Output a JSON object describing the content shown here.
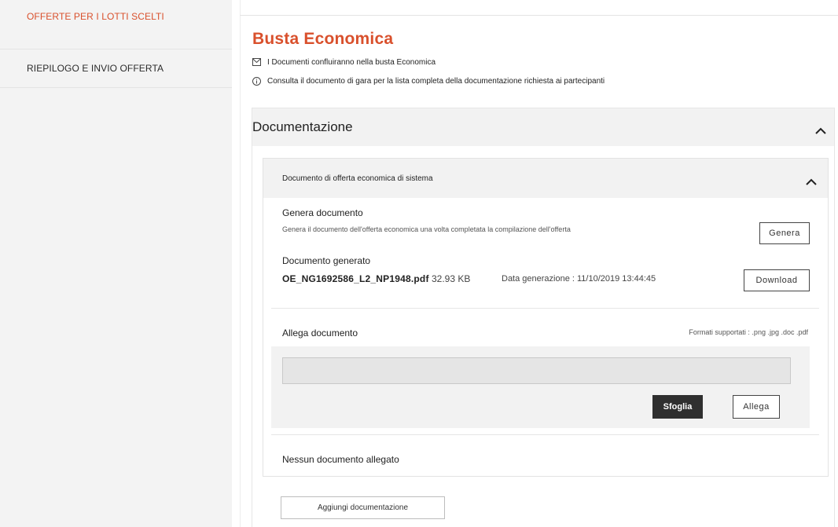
{
  "sidebar": {
    "items": [
      {
        "label": "OFFERTE PER I LOTTI SCELTI",
        "active": true
      },
      {
        "label": "RIEPILOGO E INVIO OFFERTA",
        "active": false
      }
    ]
  },
  "main": {
    "title": "Busta Economica",
    "notes": [
      {
        "icon": "envelope-icon",
        "text": "I Documenti confluiranno nella busta Economica"
      },
      {
        "icon": "info-icon",
        "text": "Consulta il documento di gara per la lista completa della documentazione richiesta ai partecipanti"
      }
    ],
    "documentazione": {
      "label": "Documentazione",
      "inner": {
        "label": "Documento di offerta economica di sistema",
        "genera": {
          "heading": "Genera documento",
          "description": "Genera il documento dell'offerta economica una volta completata la compilazione dell'offerta",
          "button": "Genera"
        },
        "generato": {
          "heading": "Documento generato",
          "filename": "OE_NG1692586_L2_NP1948.pdf",
          "size": "32.93 KB",
          "date_label": "Data generazione : 11/10/2019 13:44:45",
          "button": "Download"
        },
        "allega": {
          "heading": "Allega documento",
          "formats": "Formati supportati : .png .jpg .doc .pdf",
          "browse_button": "Sfoglia",
          "attach_button": "Allega"
        },
        "status": "Nessun documento allegato"
      }
    },
    "add_button": "Aggiungi documentazione"
  },
  "colors": {
    "accent": "#d9502c",
    "dark_button": "#2f2f2f",
    "panel_bg": "#f2f2f2"
  }
}
